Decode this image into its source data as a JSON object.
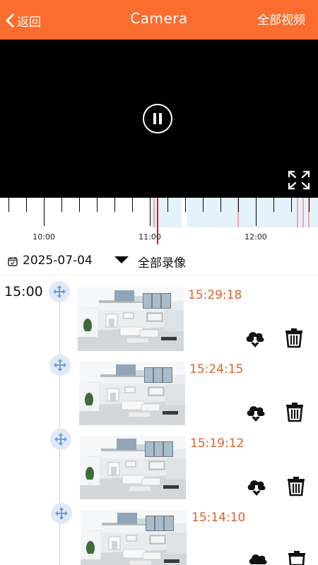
{
  "header": {
    "back_label": "返回",
    "title": "Camera",
    "all_videos_label": "全部视频"
  },
  "timeline": {
    "labels": [
      "10:00",
      "11:00",
      "12:00"
    ]
  },
  "date_bar": {
    "date": "2025-07-04",
    "filter_label": "全部录像"
  },
  "recordings": {
    "hour_label": "15:00",
    "items": [
      {
        "time": "15:29:18"
      },
      {
        "time": "15:24:15"
      },
      {
        "time": "15:19:12"
      },
      {
        "time": "15:14:10"
      }
    ]
  },
  "icons": {
    "back": "chevron-left-icon",
    "pause": "pause-icon",
    "fullscreen": "fullscreen-icon",
    "calendar": "calendar-icon",
    "dropdown": "triangle-down-icon",
    "node": "move-arrows-icon",
    "download": "cloud-download-icon",
    "delete": "trash-icon"
  },
  "colors": {
    "accent": "#fb6d2f",
    "time_text": "#d9642a",
    "cursor": "#e41616",
    "recording_band": "#e4f2fc"
  }
}
